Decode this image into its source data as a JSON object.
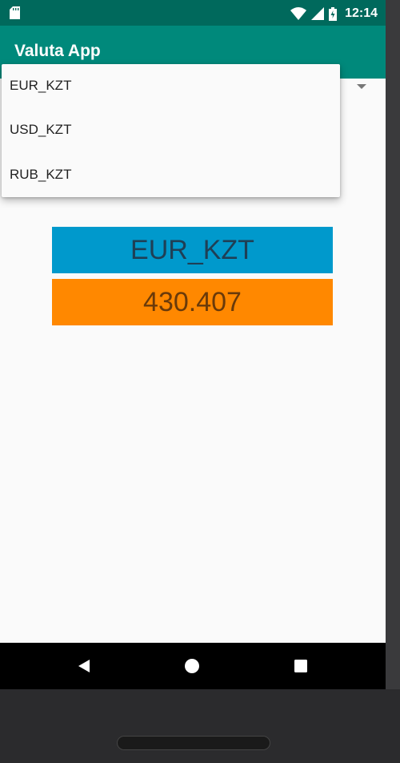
{
  "status_bar": {
    "time": "12:14"
  },
  "app_bar": {
    "title": "Valuta App"
  },
  "dropdown": {
    "items": [
      "EUR_KZT",
      "USD_KZT",
      "RUB_KZT"
    ]
  },
  "result": {
    "currency_pair": "EUR_KZT",
    "rate": "430.407"
  },
  "colors": {
    "status_bar": "#00695c",
    "app_bar": "#00897b",
    "currency_bg": "#0099cc",
    "rate_bg": "#ff8800"
  },
  "icons": {
    "status": [
      "sd-card-icon",
      "wifi-icon",
      "signal-icon",
      "battery-icon"
    ],
    "navigation": [
      "back-icon",
      "home-icon",
      "recents-icon"
    ],
    "spinner": "dropdown-arrow-icon"
  }
}
